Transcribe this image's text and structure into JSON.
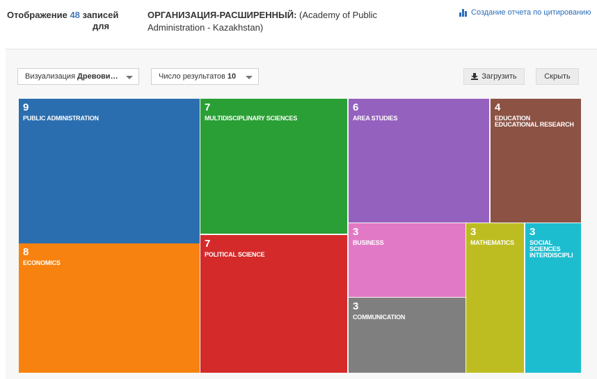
{
  "header": {
    "showing_prefix": "Отображение",
    "showing_count": "48",
    "showing_suffix": "записей",
    "showing_for": "для",
    "query_field": "ОРГАНИЗАЦИЯ-РАСШИРЕННЫЙ:",
    "query_value_line1": "(Academy of Public",
    "query_value_line2": "Administration - Kazakhstan)",
    "citation_report_link": "Создание отчета по цитированию",
    "citation_icon": "bar-chart-icon"
  },
  "controls": {
    "visualization_label": "Визуализация",
    "visualization_value": "Древови…",
    "results_label": "Число результатов",
    "results_value": "10",
    "download_label": "Загрузить",
    "download_icon": "download-icon",
    "hide_label": "Скрыть"
  },
  "treemap": {
    "tiles": [
      {
        "count": "9",
        "label": "PUBLIC ADMINISTRATION",
        "color": "#2a6eb0"
      },
      {
        "count": "8",
        "label": "ECONOMICS",
        "color": "#f7820f"
      },
      {
        "count": "7",
        "label": "MULTIDISCIPLINARY SCIENCES",
        "color": "#2a9f35"
      },
      {
        "count": "7",
        "label": "POLITICAL SCIENCE",
        "color": "#d42a2a"
      },
      {
        "count": "6",
        "label": "AREA STUDIES",
        "color": "#9561bf"
      },
      {
        "count": "4",
        "label": "EDUCATION\nEDUCATIONAL RESEARCH",
        "color": "#8c5244"
      },
      {
        "count": "3",
        "label": "BUSINESS",
        "color": "#e279c6"
      },
      {
        "count": "3",
        "label": "COMMUNICATION",
        "color": "#7f7f7f"
      },
      {
        "count": "3",
        "label": "MATHEMATICS",
        "color": "#bdbd22"
      },
      {
        "count": "3",
        "label": "SOCIAL\nSCIENCES\nINTERDISCIPLI",
        "color": "#1dbdd0"
      }
    ]
  }
}
